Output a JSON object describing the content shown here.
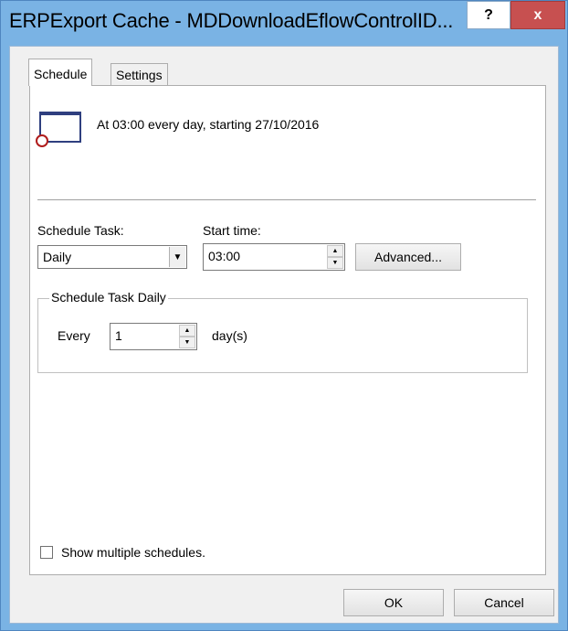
{
  "window": {
    "title": "ERPExport Cache - MDDownloadEflowControlID...",
    "help_label": "?",
    "close_label": "x"
  },
  "tabs": [
    {
      "label": "Schedule",
      "selected": true
    },
    {
      "label": "Settings",
      "selected": false
    }
  ],
  "schedule": {
    "summary": "At 03:00 every day, starting 27/10/2016",
    "schedule_task_label": "Schedule Task:",
    "schedule_task_value": "Daily",
    "start_time_label": "Start time:",
    "start_time_value": "03:00",
    "advanced_label": "Advanced...",
    "group_title": "Schedule Task Daily",
    "every_label": "Every",
    "every_value": "1",
    "days_label": "day(s)",
    "show_multiple_label": "Show multiple schedules.",
    "show_multiple_checked": false
  },
  "buttons": {
    "ok": "OK",
    "cancel": "Cancel"
  },
  "colors": {
    "title_bar": "#7ab3e4",
    "close_button": "#c75050"
  },
  "icons": {
    "task": "calendar-icon",
    "dropdown": "chevron-down-icon",
    "spin": "spin-arrows-icon"
  }
}
